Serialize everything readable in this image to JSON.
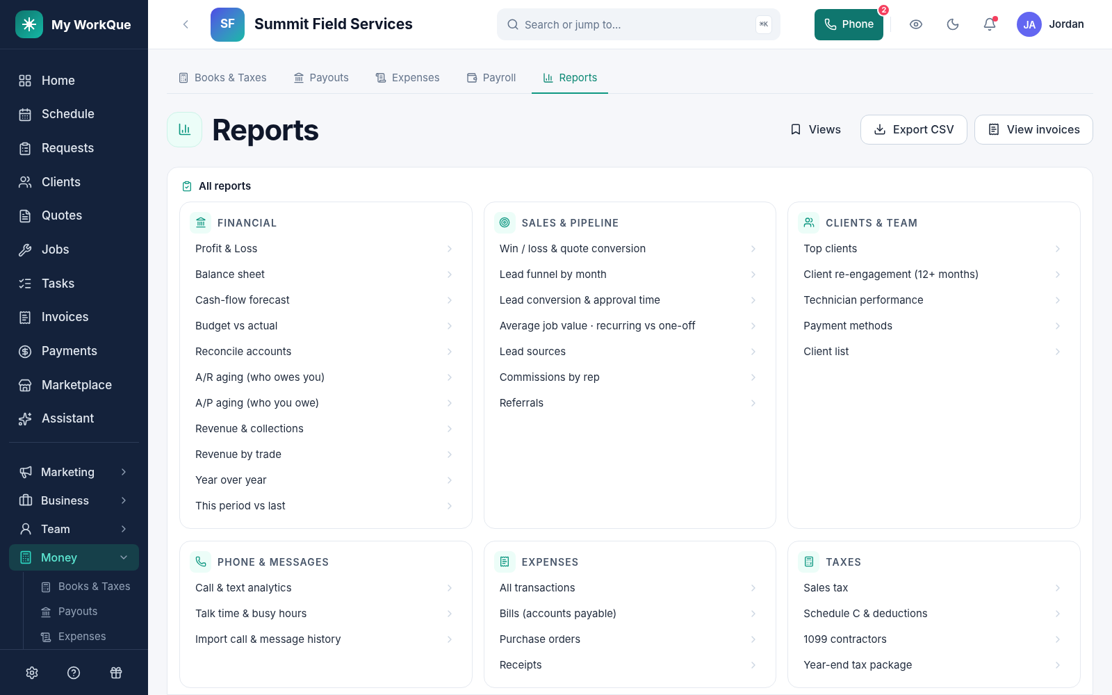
{
  "sidebar": {
    "brand": "My WorkQue",
    "items": [
      {
        "label": "Home"
      },
      {
        "label": "Schedule"
      },
      {
        "label": "Requests"
      },
      {
        "label": "Clients"
      },
      {
        "label": "Quotes"
      },
      {
        "label": "Jobs"
      },
      {
        "label": "Tasks"
      },
      {
        "label": "Invoices"
      },
      {
        "label": "Payments"
      },
      {
        "label": "Marketplace"
      },
      {
        "label": "Assistant"
      }
    ],
    "groups": [
      {
        "label": "Marketing",
        "selected": false,
        "expanded": false
      },
      {
        "label": "Business",
        "selected": false,
        "expanded": false
      },
      {
        "label": "Team",
        "selected": false,
        "expanded": false
      },
      {
        "label": "Money",
        "selected": true,
        "expanded": true,
        "children": [
          {
            "label": "Books & Taxes"
          },
          {
            "label": "Payouts"
          },
          {
            "label": "Expenses"
          }
        ]
      }
    ]
  },
  "topbar": {
    "org_initials": "SF",
    "org_name": "Summit Field Services",
    "search": {
      "placeholder": "Search or jump to...",
      "shortcut": "⌘K"
    },
    "phone": {
      "label": "Phone",
      "badge": "2"
    },
    "notifications_unread": true,
    "user": {
      "initials": "JA",
      "name": "Jordan"
    }
  },
  "tabs": [
    {
      "label": "Books & Taxes",
      "selected": false
    },
    {
      "label": "Payouts",
      "selected": false
    },
    {
      "label": "Expenses",
      "selected": false
    },
    {
      "label": "Payroll",
      "selected": false
    },
    {
      "label": "Reports",
      "selected": true
    }
  ],
  "page": {
    "title": "Reports",
    "actions": [
      {
        "label": "Views",
        "kind": "ghost"
      },
      {
        "label": "Export CSV",
        "kind": "outline"
      },
      {
        "label": "View invoices",
        "kind": "outline"
      }
    ]
  },
  "all_reports": {
    "title": "All reports",
    "sections": [
      {
        "title": "FINANCIAL",
        "items": [
          "Profit & Loss",
          "Balance sheet",
          "Cash-flow forecast",
          "Budget vs actual",
          "Reconcile accounts",
          "A/R aging (who owes you)",
          "A/P aging (who you owe)",
          "Revenue & collections",
          "Revenue by trade",
          "Year over year",
          "This period vs last"
        ]
      },
      {
        "title": "SALES & PIPELINE",
        "items": [
          "Win / loss & quote conversion",
          "Lead funnel by month",
          "Lead conversion & approval time",
          "Average job value · recurring vs one-off",
          "Lead sources",
          "Commissions by rep",
          "Referrals"
        ]
      },
      {
        "title": "CLIENTS & TEAM",
        "items": [
          "Top clients",
          "Client re-engagement (12+ months)",
          "Technician performance",
          "Payment methods",
          "Client list"
        ]
      },
      {
        "title": "PHONE & MESSAGES",
        "items": [
          "Call & text analytics",
          "Talk time & busy hours",
          "Import call & message history"
        ]
      },
      {
        "title": "EXPENSES",
        "items": [
          "All transactions",
          "Bills (accounts payable)",
          "Purchase orders",
          "Receipts"
        ]
      },
      {
        "title": "TAXES",
        "items": [
          "Sales tax",
          "Schedule C & deductions",
          "1099 contractors",
          "Year-end tax package"
        ]
      }
    ]
  }
}
